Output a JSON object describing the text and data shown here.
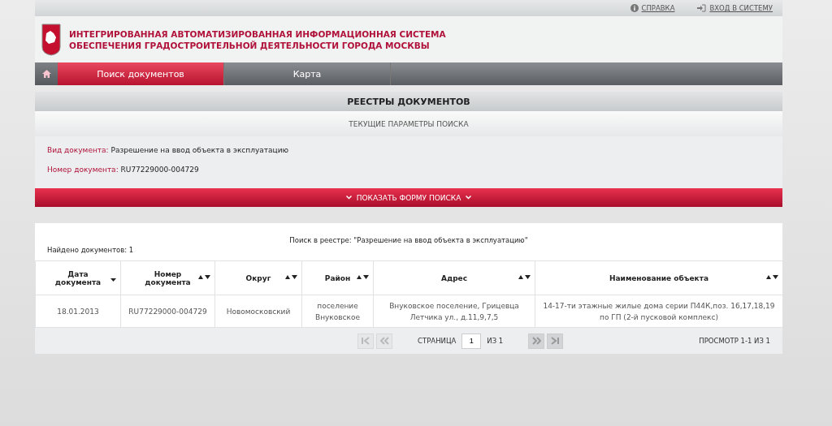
{
  "top_links": [
    {
      "kind": "info",
      "label": "СПРАВКА"
    },
    {
      "kind": "login",
      "label": "ВХОД В СИСТЕМУ"
    }
  ],
  "header": {
    "title_lines": [
      "ИНТЕГРИРОВАННАЯ АВТОМАТИЗИРОВАННАЯ ИНФОРМАЦИОННАЯ СИСТЕМА",
      "ОБЕСПЕЧЕНИЯ ГРАДОСТРОИТЕЛЬНОЙ ДЕЯТЕЛЬНОСТИ ГОРОДА МОСКВЫ"
    ]
  },
  "nav_tabs": [
    {
      "label": "Поиск документов",
      "selected": true
    },
    {
      "label": "Карта",
      "selected": false
    }
  ],
  "registry_title": "РЕЕСТРЫ ДОКУМЕНТОВ",
  "params_title": "ТЕКУЩИЕ ПАРАМЕТРЫ ПОИСКА",
  "params": [
    {
      "label": "Вид документа:",
      "value": "Разрешение на ввод объекта в эксплуатацию"
    },
    {
      "label": "Номер документа:",
      "value": "RU77229000-004729"
    }
  ],
  "show_form_button": "ПОКАЗАТЬ ФОРМУ ПОИСКА",
  "search_caption": "Поиск в реестре: \"Разрешение на ввод объекта в эксплуатацию\"",
  "found_count": "Найдено документов: 1",
  "table": {
    "columns": [
      {
        "label": "Дата документа",
        "sorted": true
      },
      {
        "label": "Номер документа",
        "sorted": false
      },
      {
        "label": "Округ",
        "sorted": false
      },
      {
        "label": "Район",
        "sorted": false
      },
      {
        "label": "Адрес",
        "sorted": false
      },
      {
        "label": "Наименование объекта",
        "sorted": false
      }
    ],
    "rows": [
      [
        "18.01.2013",
        "RU77229000-004729",
        "Новомосковский",
        "поселение Внуковское",
        "Внуковское поселение, Грицевца Летчика ул., д.11,9,7,5",
        "14-17-ти этажные жилые дома серии П44К,поз. 16,17,18,19 по ГП (2-й пусковой комплекс)"
      ]
    ]
  },
  "pager": {
    "page_label": "СТРАНИЦА",
    "page": "1",
    "of_label": "ИЗ 1",
    "first_disabled": true,
    "prev_disabled": true,
    "next_disabled": false,
    "last_disabled": false,
    "summary": "ПРОСМОТР 1-1 ИЗ 1"
  }
}
